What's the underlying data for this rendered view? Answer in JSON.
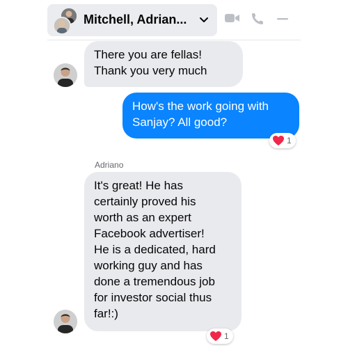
{
  "header": {
    "title": "Mitchell, Adrian...",
    "icons": [
      "group-avatar",
      "chevron-down-icon",
      "video-camera-icon",
      "phone-icon",
      "minimize-icon"
    ],
    "icon_color": "#bcc0c4"
  },
  "messages": [
    {
      "direction": "incoming",
      "text": "There you are fellas!\nThank you very much"
    },
    {
      "direction": "outgoing",
      "text": "How's the work going with\nSanjay? All good?",
      "reaction": {
        "emoji": "heart",
        "count": "1"
      }
    },
    {
      "direction": "incoming",
      "sender": "Adriano",
      "text": "It's great! He has\ncertainly proved his\nworth as an expert\nFacebook advertiser!\nHe is a dedicated, hard\nworking guy and has\ndone a tremendous job\nfor investor social thus\nfar!:)",
      "reaction": {
        "emoji": "heart",
        "count": "1"
      }
    }
  ],
  "colors": {
    "outgoing_bubble": "#0a84ff",
    "incoming_bubble": "#e9eaee",
    "reaction_heart": "#f0284a"
  }
}
